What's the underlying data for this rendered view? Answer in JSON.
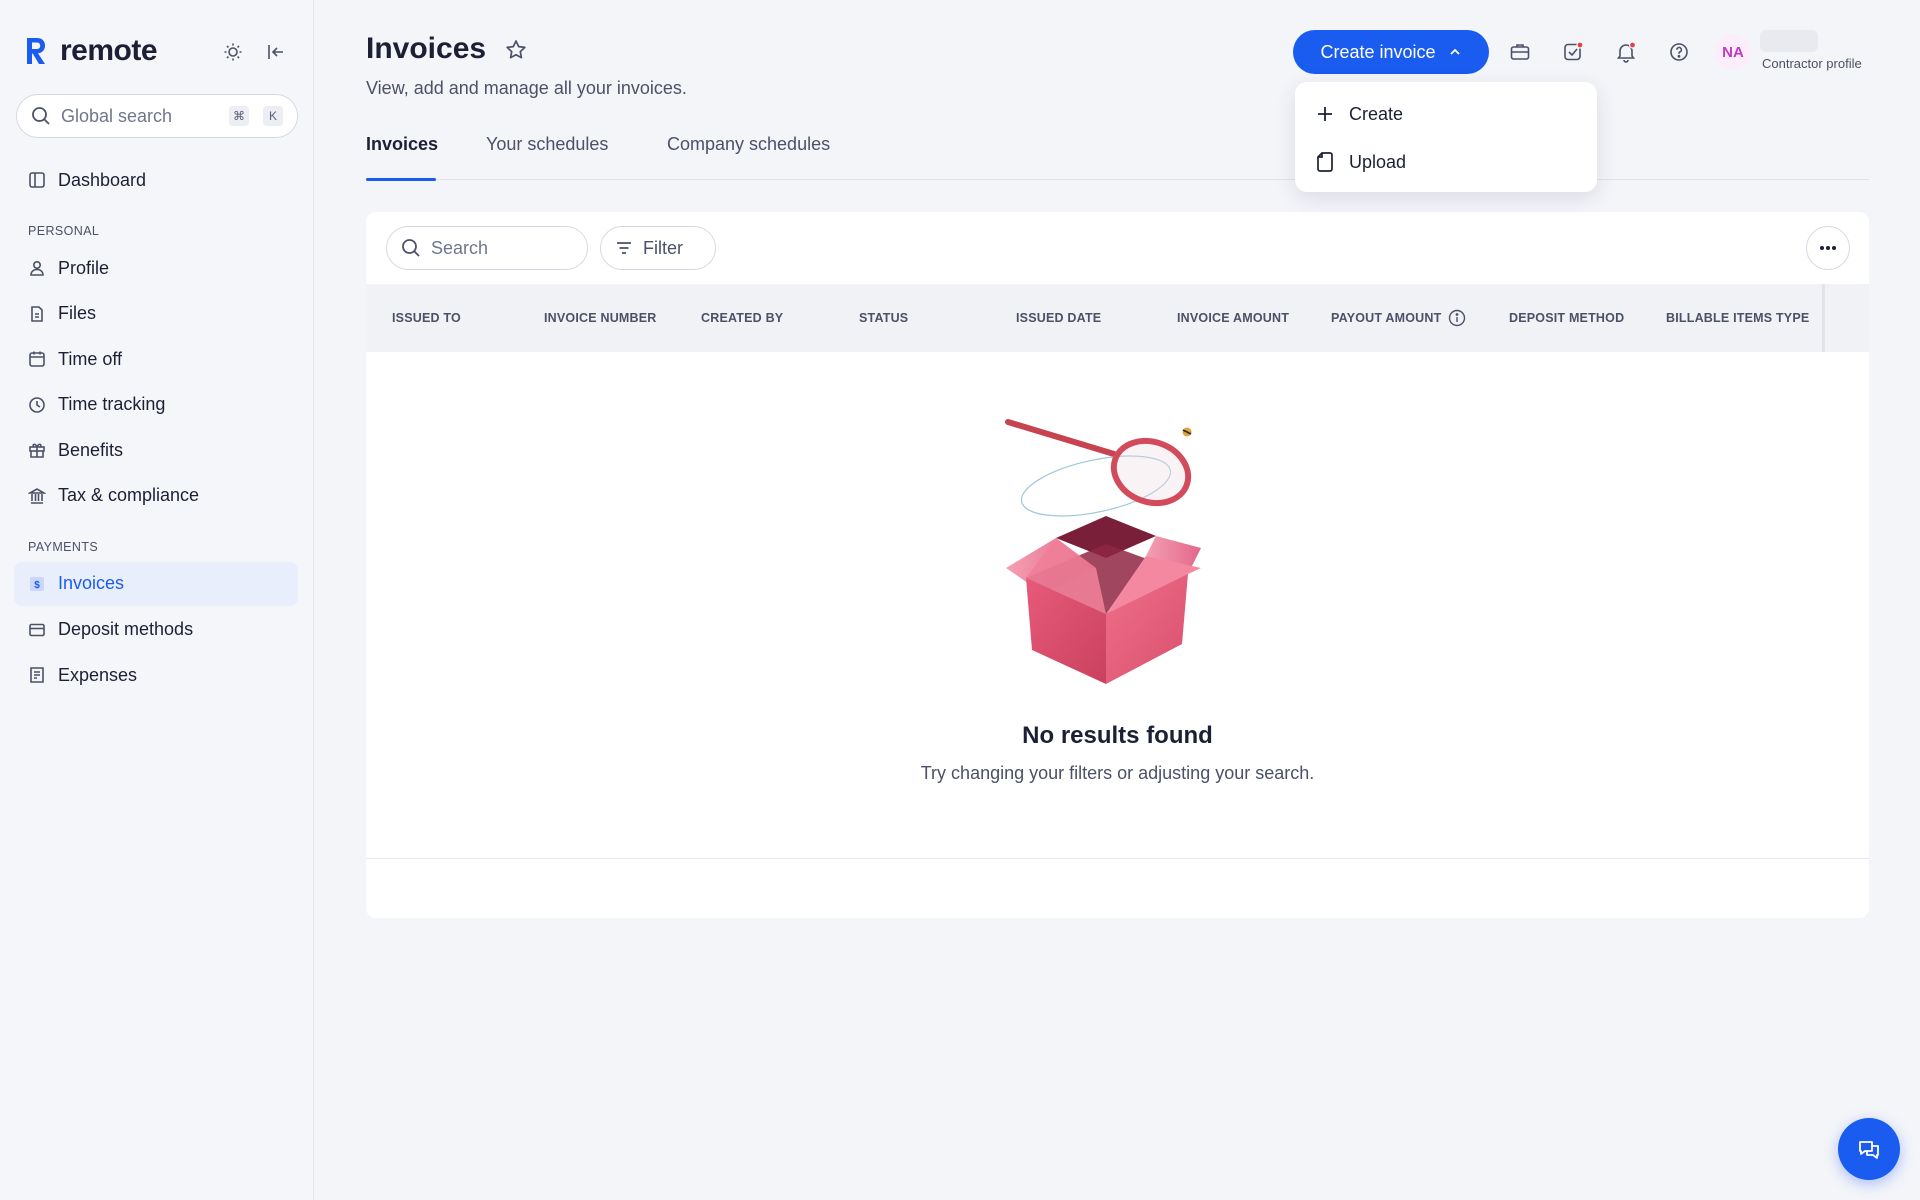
{
  "brand": {
    "name": "remote"
  },
  "sidebar": {
    "search_placeholder": "Global search",
    "kbd_cmd": "⌘",
    "kbd_k": "K",
    "dashboard": "Dashboard",
    "section_personal": "PERSONAL",
    "personal_items": [
      {
        "label": "Profile",
        "icon": "person-icon"
      },
      {
        "label": "Files",
        "icon": "file-icon"
      },
      {
        "label": "Time off",
        "icon": "calendar-icon"
      },
      {
        "label": "Time tracking",
        "icon": "clock-icon"
      },
      {
        "label": "Benefits",
        "icon": "gift-icon"
      },
      {
        "label": "Tax & compliance",
        "icon": "bank-icon"
      }
    ],
    "section_payments": "PAYMENTS",
    "payment_items": [
      {
        "label": "Invoices",
        "icon": "invoice-icon",
        "active": true
      },
      {
        "label": "Deposit methods",
        "icon": "card-icon"
      },
      {
        "label": "Expenses",
        "icon": "receipt-icon"
      }
    ]
  },
  "header": {
    "title": "Invoices",
    "subtitle": "View, add and manage all your invoices.",
    "create_button": "Create invoice",
    "avatar_initials": "NA",
    "profile_label": "Contractor profile"
  },
  "dropdown": {
    "items": [
      {
        "label": "Create",
        "icon": "plus-icon"
      },
      {
        "label": "Upload",
        "icon": "upload-file-icon"
      }
    ]
  },
  "tabs": [
    {
      "label": "Invoices",
      "active": true
    },
    {
      "label": "Your schedules"
    },
    {
      "label": "Company schedules"
    }
  ],
  "table": {
    "search_placeholder": "Search",
    "filter_label": "Filter",
    "columns": [
      "ISSUED TO",
      "INVOICE NUMBER",
      "CREATED BY",
      "STATUS",
      "ISSUED DATE",
      "INVOICE AMOUNT",
      "PAYOUT AMOUNT",
      "DEPOSIT METHOD",
      "BILLABLE ITEMS TYPE"
    ]
  },
  "empty_state": {
    "title": "No results found",
    "subtitle": "Try changing your filters or adjusting your search."
  },
  "colors": {
    "accent": "#1a5bf0",
    "sidebar_bg": "#f5f6fa",
    "avatar_text": "#c23bbd",
    "notification_dot": "#ef3b45"
  }
}
